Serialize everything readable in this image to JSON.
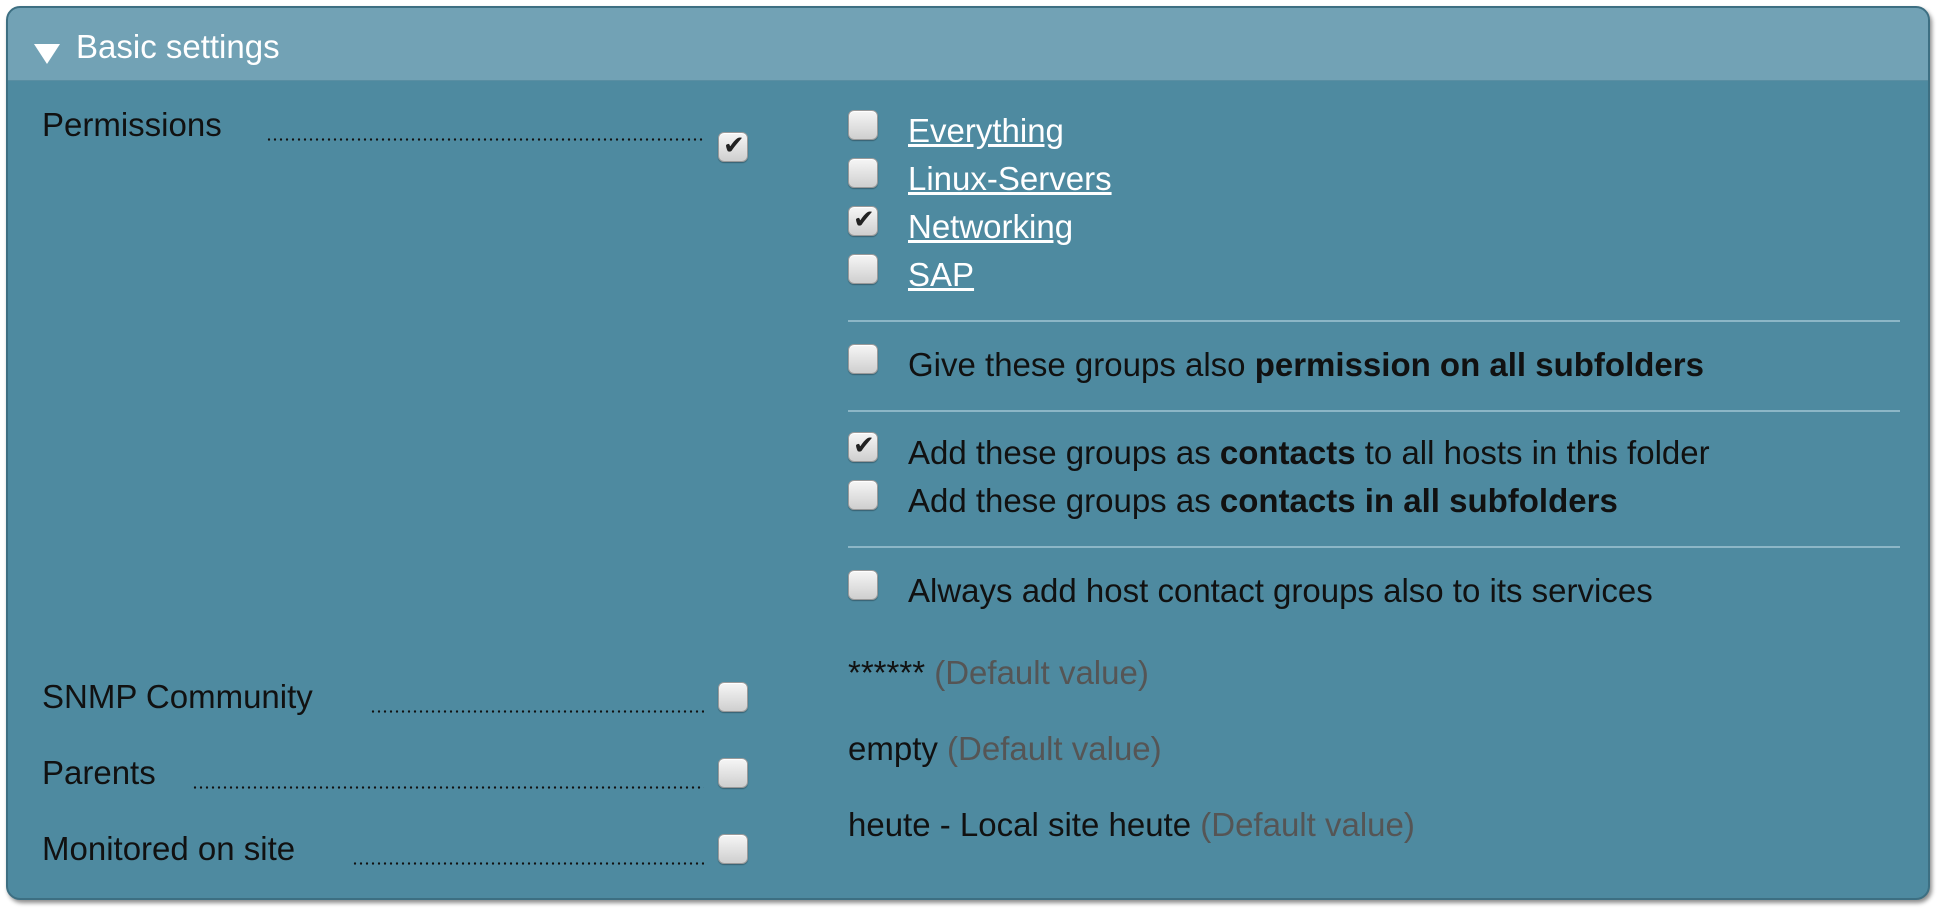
{
  "header": {
    "title": "Basic settings",
    "collapse_icon": "triangle-down-icon"
  },
  "left": [
    {
      "label": "Permissions",
      "checked": true
    },
    {
      "label": "SNMP Community",
      "checked": false
    },
    {
      "label": "Parents",
      "checked": false
    },
    {
      "label": "Monitored on site",
      "checked": false
    }
  ],
  "groups": [
    {
      "label": "Everything",
      "checked": false
    },
    {
      "label": "Linux-Servers",
      "checked": false
    },
    {
      "label": "Networking",
      "checked": true
    },
    {
      "label": "SAP",
      "checked": false
    }
  ],
  "options": {
    "subfolders": {
      "checked": false,
      "pre": "Give these groups also ",
      "bold": "permission on all subfolders",
      "post": ""
    },
    "contacts": {
      "checked": true,
      "pre": "Add these groups as ",
      "bold": "contacts",
      "post": " to all hosts in this folder"
    },
    "contacts_sub": {
      "checked": false,
      "pre": "Add these groups as ",
      "bold": "contacts in all subfolders",
      "post": ""
    },
    "services": {
      "checked": false,
      "text": "Always add host contact groups also to its services"
    }
  },
  "values": {
    "snmp": {
      "value": "******",
      "default": "(Default value)"
    },
    "parents": {
      "value": "empty",
      "default": "(Default value)"
    },
    "site": {
      "value": "heute - Local site heute",
      "default": "(Default value)"
    }
  },
  "colors": {
    "panel": "#4e8aa0",
    "header": "#72a2b5",
    "link": "#ffffff",
    "default_text": "#555555"
  }
}
